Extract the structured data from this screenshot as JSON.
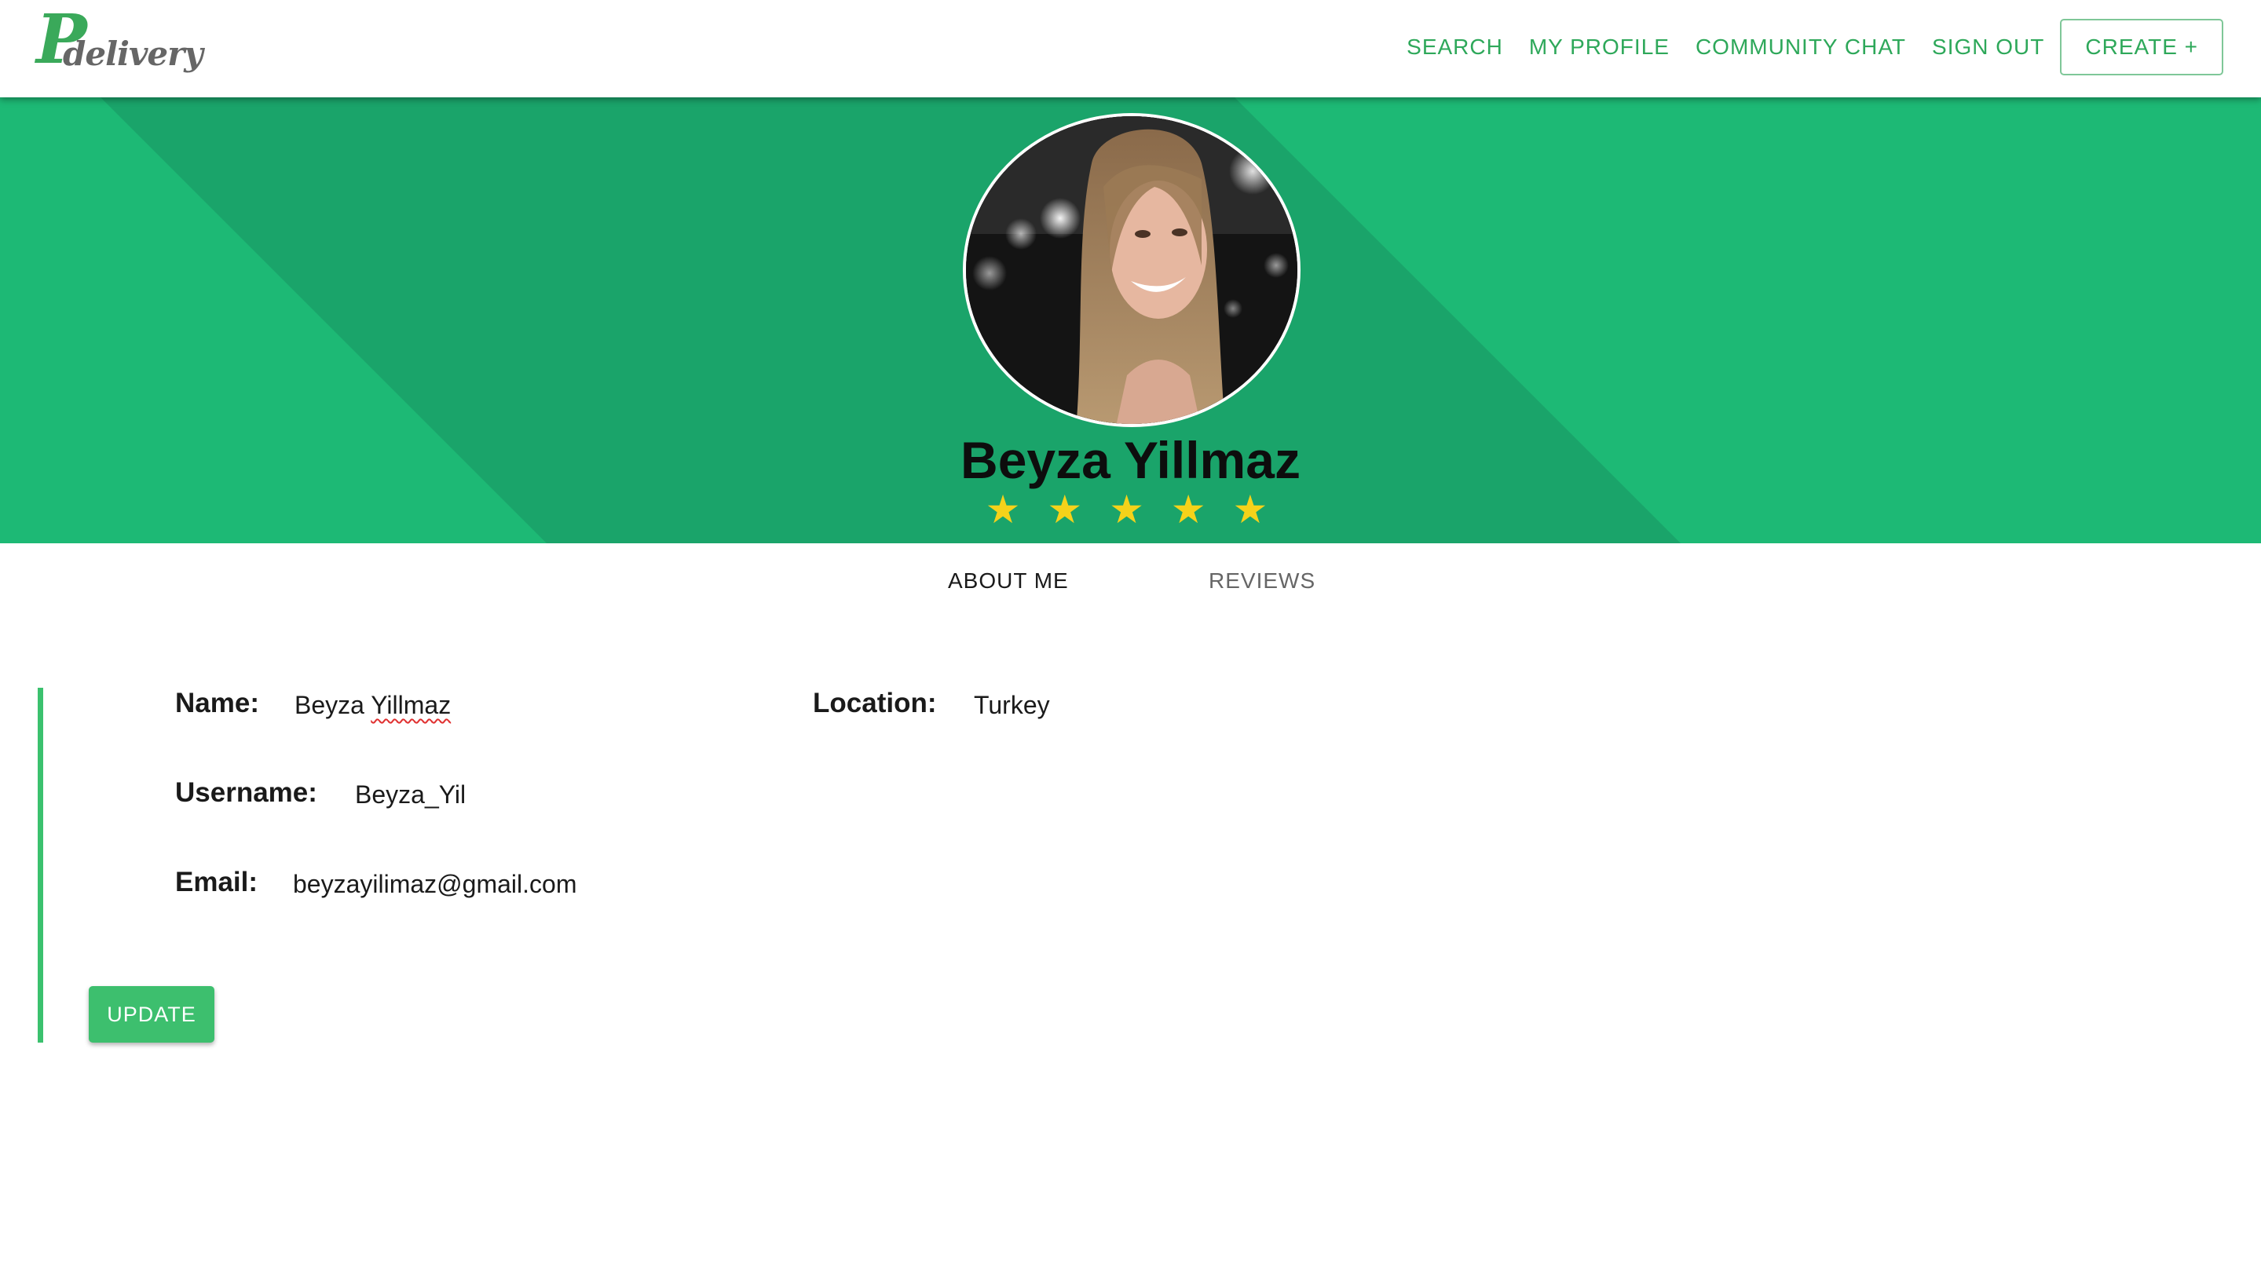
{
  "brand": {
    "logo_letter": "P",
    "logo_text": "delivery"
  },
  "nav": {
    "links": [
      "SEARCH",
      "MY PROFILE",
      "COMMUNITY CHAT",
      "SIGN OUT"
    ],
    "create_label": "CREATE +"
  },
  "profile": {
    "name": "Beyza Yillmaz",
    "rating": 5,
    "stars": "★ ★ ★ ★ ★"
  },
  "tabs": {
    "about": "ABOUT ME",
    "reviews": "REVIEWS",
    "active": "about"
  },
  "about": {
    "name_label": "Name:",
    "name_first": "Beyza ",
    "name_last": "Yillmaz",
    "location_label": "Location:",
    "location_value": "Turkey",
    "username_label": "Username:",
    "username_value": "Beyza_Yil",
    "email_label": "Email:",
    "email_value": "beyzayilimaz@gmail.com",
    "update_label": "UPDATE"
  },
  "colors": {
    "brand_green": "#2ea85a",
    "hero_light": "#1db975",
    "hero_dark": "#1aa46a",
    "accent_bar": "#3bc16e",
    "star": "#f5d21a"
  }
}
